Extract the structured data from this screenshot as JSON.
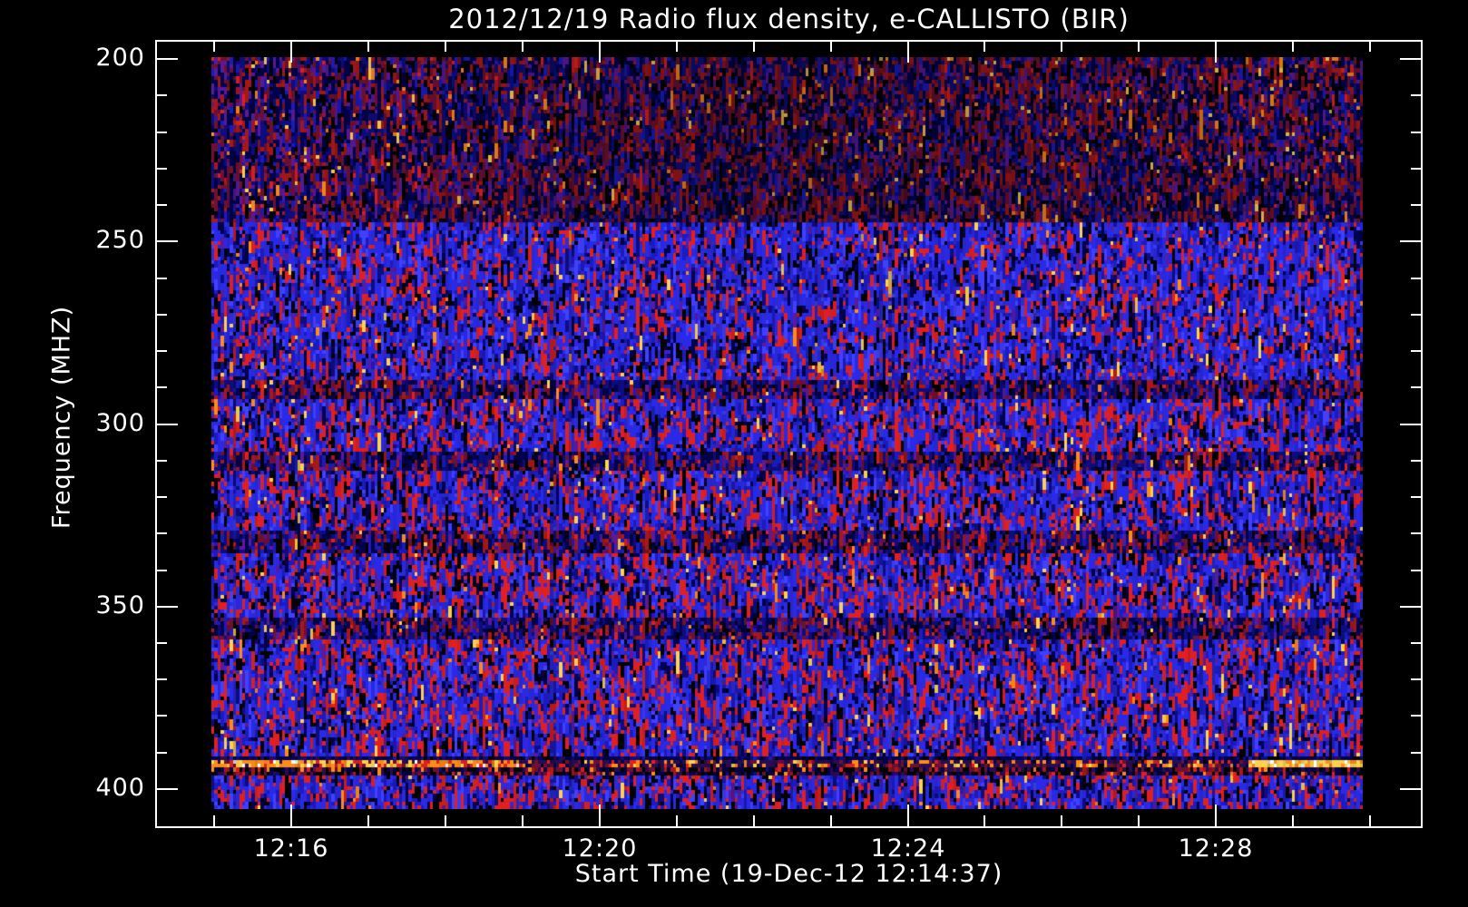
{
  "window": {
    "background": "#000000",
    "foreground": "#ffffff"
  },
  "chart_data": {
    "type": "heatmap",
    "subtype": "radio-spectrogram",
    "title": "2012/12/19  Radio flux density, e-CALLISTO (BIR)",
    "date": "2012/12/19",
    "instrument": "e-CALLISTO (BIR)",
    "xlabel": "Start Time (19-Dec-12 12:14:37)",
    "ylabel": "Frequency (MHZ)",
    "x_range_sec": [
      44055,
      45040
    ],
    "x_major_ticks": [
      {
        "label": "12:16",
        "t": 44160
      },
      {
        "label": "12:20",
        "t": 44400
      },
      {
        "label": "12:24",
        "t": 44640
      },
      {
        "label": "12:28",
        "t": 44880
      }
    ],
    "x_minor_ticks_sec": [
      44100,
      44220,
      44280,
      44340,
      44460,
      44520,
      44580,
      44700,
      44760,
      44820,
      44940,
      45000
    ],
    "y_range_mhz": [
      195.0,
      410.2
    ],
    "y_major_ticks": [
      200,
      250,
      300,
      350,
      400
    ],
    "y_minor_ticks": [
      210,
      220,
      230,
      240,
      260,
      270,
      280,
      290,
      310,
      320,
      330,
      340,
      360,
      370,
      380,
      390
    ],
    "y_axis_inverted": true,
    "grid": false,
    "legend": "none",
    "image_time_range_sec": [
      44098,
      44995
    ],
    "image_freq_range_mhz": [
      199.6,
      405.8
    ],
    "noise_grid": {
      "cols": 374,
      "rows": 200,
      "seed": 20121219
    },
    "colors": {
      "blue": "#2a2ae6",
      "blue2": "#1b1bbf",
      "blue3": "#4040ff",
      "darkNavy": "#00004d",
      "navy2": "#0d0d80",
      "red": "#e02020",
      "red2": "#a81818",
      "maroon": "#701030",
      "purple": "#5a1a9a",
      "darkPurple": "#2a0d50",
      "black": "#000000",
      "orange": "#ff8c1a",
      "yellow": "#ffd24d",
      "white": "#ffffff"
    },
    "palettes": {
      "upperDark": [
        [
          "darkNavy",
          0.2
        ],
        [
          "maroon",
          0.18
        ],
        [
          "navy2",
          0.14
        ],
        [
          "black",
          0.12
        ],
        [
          "red2",
          0.12
        ],
        [
          "purple",
          0.1
        ],
        [
          "blue2",
          0.08
        ],
        [
          "red",
          0.03
        ],
        [
          "orange",
          0.02
        ],
        [
          "yellow",
          0.01
        ]
      ],
      "blueField": [
        [
          "blue",
          0.34
        ],
        [
          "blue3",
          0.12
        ],
        [
          "blue2",
          0.12
        ],
        [
          "red",
          0.16
        ],
        [
          "darkNavy",
          0.08
        ],
        [
          "black",
          0.08
        ],
        [
          "navy2",
          0.05
        ],
        [
          "purple",
          0.03
        ],
        [
          "yellow",
          0.01
        ],
        [
          "orange",
          0.01
        ]
      ],
      "standard": [
        [
          "blue",
          0.3
        ],
        [
          "blue3",
          0.1
        ],
        [
          "blue2",
          0.12
        ],
        [
          "red",
          0.22
        ],
        [
          "black",
          0.09
        ],
        [
          "darkNavy",
          0.07
        ],
        [
          "navy2",
          0.05
        ],
        [
          "purple",
          0.03
        ],
        [
          "yellow",
          0.01
        ],
        [
          "orange",
          0.01
        ]
      ],
      "darkStripe": [
        [
          "navy2",
          0.2
        ],
        [
          "darkNavy",
          0.18
        ],
        [
          "blue2",
          0.15
        ],
        [
          "red2",
          0.14
        ],
        [
          "black",
          0.12
        ],
        [
          "maroon",
          0.1
        ],
        [
          "purple",
          0.06
        ],
        [
          "red",
          0.03
        ],
        [
          "orange",
          0.01
        ],
        [
          "yellow",
          0.01
        ]
      ],
      "navyLane": [
        [
          "darkNavy",
          0.55
        ],
        [
          "navy2",
          0.2
        ],
        [
          "black",
          0.12
        ],
        [
          "darkPurple",
          0.08
        ],
        [
          "blue2",
          0.05
        ]
      ],
      "rfiMid": [
        [
          "darkPurple",
          0.42
        ],
        [
          "maroon",
          0.14
        ],
        [
          "orange",
          0.16
        ],
        [
          "red",
          0.1
        ],
        [
          "darkNavy",
          0.1
        ],
        [
          "yellow",
          0.05
        ],
        [
          "black",
          0.03
        ]
      ],
      "rfiLeftBright": [
        [
          "orange",
          0.38
        ],
        [
          "red",
          0.18
        ],
        [
          "yellow",
          0.22
        ],
        [
          "white",
          0.06
        ],
        [
          "darkPurple",
          0.1
        ],
        [
          "maroon",
          0.06
        ]
      ],
      "rfiRightYellow": [
        [
          "yellow",
          0.6
        ],
        [
          "orange",
          0.25
        ],
        [
          "white",
          0.15
        ]
      ],
      "darkLane": [
        [
          "black",
          0.28
        ],
        [
          "darkNavy",
          0.22
        ],
        [
          "darkPurple",
          0.18
        ],
        [
          "maroon",
          0.12
        ],
        [
          "red2",
          0.1
        ],
        [
          "red",
          0.05
        ],
        [
          "orange",
          0.04
        ],
        [
          "navy2",
          0.01
        ]
      ]
    },
    "bands": [
      {
        "f": [
          199.6,
          245.0
        ],
        "palette": "upperDark",
        "shade": [
          [
            0,
            0
          ],
          [
            0.15,
            0.08
          ],
          [
            0.45,
            0.28
          ],
          [
            0.78,
            0.22
          ],
          [
            1,
            0.12
          ]
        ]
      },
      {
        "f": [
          245.0,
          288.0
        ],
        "palette": "blueField"
      },
      {
        "f": [
          288.0,
          293.0
        ],
        "palette": "darkStripe"
      },
      {
        "f": [
          293.0,
          308.0
        ],
        "palette": "standard"
      },
      {
        "f": [
          308.0,
          313.0
        ],
        "palette": "darkStripe"
      },
      {
        "f": [
          313.0,
          330.0
        ],
        "palette": "standard"
      },
      {
        "f": [
          330.0,
          336.0
        ],
        "palette": "darkStripe"
      },
      {
        "f": [
          336.0,
          353.0
        ],
        "palette": "standard"
      },
      {
        "f": [
          353.0,
          359.0
        ],
        "palette": "darkStripe"
      },
      {
        "f": [
          359.0,
          390.9
        ],
        "palette": "standard"
      },
      {
        "f": [
          390.9,
          392.9
        ],
        "palette": "navyLane",
        "corr": false
      },
      {
        "f": [
          392.9,
          394.9
        ],
        "palette": "rfiMid",
        "corr": false,
        "overrides": [
          {
            "x": [
              0.0,
              0.27
            ],
            "palette": "rfiLeftBright"
          },
          {
            "x": [
              0.9,
              1.01
            ],
            "palette": "rfiRightYellow"
          }
        ]
      },
      {
        "f": [
          394.9,
          396.6
        ],
        "palette": "darkLane",
        "corr": false
      },
      {
        "f": [
          396.6,
          405.8
        ],
        "palette": "standard"
      }
    ],
    "features": [
      {
        "freq_mhz": [
          200,
          245
        ],
        "desc": "darker mottled band across top of spectrogram"
      },
      {
        "freq_mhz": [
          288,
          293
        ],
        "desc": "dark horizontal interference stripe"
      },
      {
        "freq_mhz": [
          308,
          313
        ],
        "desc": "dark horizontal interference stripe"
      },
      {
        "freq_mhz": [
          330,
          336
        ],
        "desc": "dark horizontal interference stripe"
      },
      {
        "freq_mhz": [
          353,
          359
        ],
        "desc": "dark horizontal interference stripe"
      },
      {
        "freq_mhz": [
          391,
          396
        ],
        "desc": "narrowband RFI line: bright orange 12:15-12:19, faint with orange dashes 12:19-12:28, saturated yellow-white 12:28-12:30"
      }
    ]
  }
}
